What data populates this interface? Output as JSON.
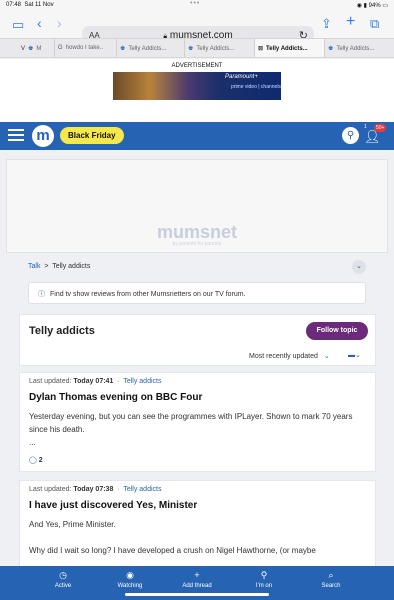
{
  "status": {
    "time": "07:48",
    "date": "Sat 11 Nov",
    "battery": "94%"
  },
  "browser": {
    "aa_label": "AA",
    "url": "mumsnet.com",
    "tabs": [
      {
        "label": "M",
        "icon": "V"
      },
      {
        "label": "howdo I take..",
        "icon": "G"
      },
      {
        "label": "Telly Addicts...",
        "icon": "m"
      },
      {
        "label": "Telly Addicts...",
        "icon": "m"
      },
      {
        "label": "Telly Addicts...",
        "icon": "m"
      },
      {
        "label": "Telly Addicts...",
        "icon": "m"
      }
    ]
  },
  "ad": {
    "label": "ADVERTISEMENT",
    "banner_brand": "Paramount+",
    "banner_sub": "prime video | channels"
  },
  "header": {
    "black_friday_label": "Black Friday",
    "notif_count": "1",
    "badge": "50+"
  },
  "ad_placeholder": {
    "brand": "mumsnet",
    "tagline": "by parents for parents"
  },
  "breadcrumb": {
    "root": "Talk",
    "separator": ">",
    "current": "Telly addicts"
  },
  "info_banner": {
    "text": "Find tv show reviews from other Mumsnetters on our TV forum."
  },
  "topic": {
    "title": "Telly addicts",
    "follow_label": "Follow topic",
    "sort_label": "Most recently updated"
  },
  "threads": [
    {
      "updated_prefix": "Last updated:",
      "updated_time": "Today 07:41",
      "category": "Telly addicts",
      "title": "Dylan Thomas evening on BBC Four",
      "excerpt": "Yesterday evening, but you can see the programmes with IPLayer. Shown to mark 70 years since his death.",
      "more": "...",
      "comments": "2"
    },
    {
      "updated_prefix": "Last updated:",
      "updated_time": "Today 07:38",
      "category": "Telly addicts",
      "title": "I have just discovered Yes, Minister",
      "excerpt": "And Yes, Prime Minister.",
      "excerpt2": "Why did I wait so long? I have developed a crush on Nigel Hawthorne, (or maybe"
    }
  ],
  "bottom_nav": [
    {
      "label": "Active",
      "icon": "clock-icon"
    },
    {
      "label": "Watching",
      "icon": "eye-icon"
    },
    {
      "label": "Add thread",
      "icon": "plus-icon"
    },
    {
      "label": "I'm on",
      "icon": "pin-icon"
    },
    {
      "label": "Search",
      "icon": "search-icon"
    }
  ]
}
